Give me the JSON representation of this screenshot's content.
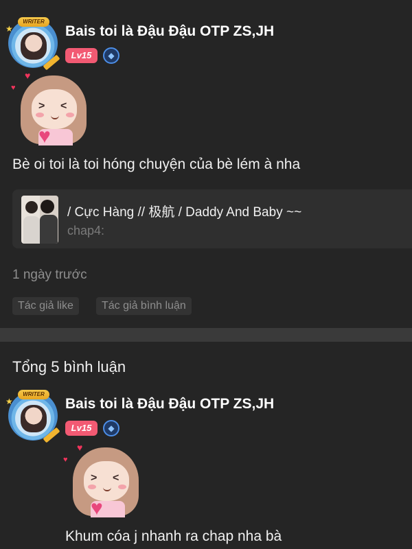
{
  "post": {
    "author": {
      "name": "Bais toi là Đậu Đậu⁠ OTP ZS,JH",
      "level": "Lv15",
      "avatar_ribbon": "WRITER",
      "badge_icon": "diamond-icon"
    },
    "sticker": "blushing-girl-sticker",
    "text": "Bè oi toi là toi hóng chuyện của bè lém à nha",
    "quote": {
      "title": "/ Cực Hàng // 极航 / Daddy And Baby ~~",
      "subtitle": "chap4:"
    },
    "time": "1 ngày trước",
    "tags": [
      "Tác giả like",
      "Tác giả bình luận"
    ]
  },
  "comments": {
    "count_label": "Tổng 5 bình luận",
    "items": [
      {
        "author": {
          "name": "Bais toi là Đậu Đậu⁠ OTP ZS,JH",
          "level": "Lv15",
          "avatar_ribbon": "WRITER",
          "badge_icon": "diamond-icon"
        },
        "sticker": "blushing-girl-sticker",
        "text": "Khum cóa j nhanh ra chap nha bà"
      }
    ]
  },
  "colors": {
    "background": "#252525",
    "level_badge": "#f25a73",
    "verified_badge": "#4d8fe8",
    "muted_text": "#8e8e8e"
  }
}
